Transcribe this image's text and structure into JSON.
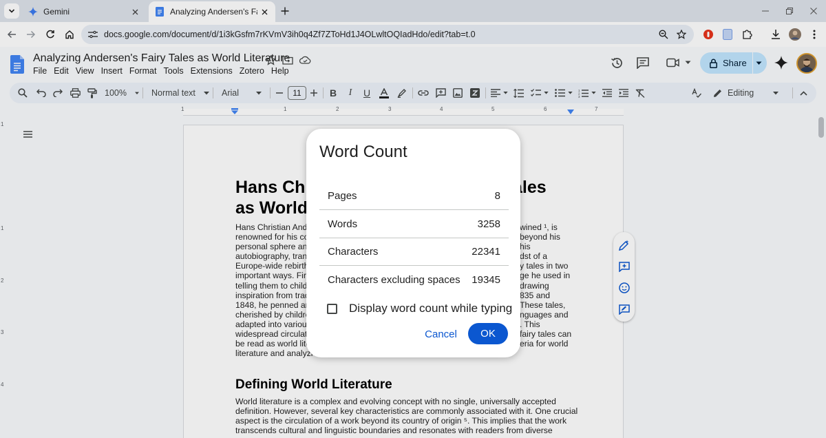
{
  "browser": {
    "tabs": [
      {
        "title": "Gemini",
        "active": false,
        "icon": "gemini-sparkle-icon"
      },
      {
        "title": "Analyzing Andersen's Fairy Tale",
        "active": true,
        "icon": "docs-icon"
      }
    ],
    "url": "docs.google.com/document/d/1i3kGsfm7rKVmV3ih0q4Zf7ZToHd1J4OLwltOQIadHdo/edit?tab=t.0"
  },
  "docs": {
    "title": "Analyzing Andersen's Fairy Tales as World Literature",
    "menu": [
      "File",
      "Edit",
      "View",
      "Insert",
      "Format",
      "Tools",
      "Extensions",
      "Zotero",
      "Help"
    ],
    "share_label": "Share"
  },
  "toolbar": {
    "zoom": "100%",
    "style": "Normal text",
    "font": "Arial",
    "font_size": "11",
    "mode": "Editing"
  },
  "ruler": {
    "numbers": [
      "1",
      "1",
      "2",
      "3",
      "4",
      "5",
      "6",
      "7"
    ],
    "vertical_numbers": [
      "1",
      "1",
      "2",
      "3",
      "4"
    ]
  },
  "document": {
    "heading_line1": "Hans Ch",
    "heading_line1_right": "ales",
    "heading_line2": "as World",
    "para1_left": [
      "Hans Christian Ande",
      "renowned for his col",
      "personal sphere and",
      "autobiography, trans",
      "Europe-wide rebirth",
      "important ways. First",
      "telling them to childre",
      "inspiration from tradi",
      "1848, he penned arc",
      "cherished by children",
      "adapted into various",
      "widespread circulatio",
      "be read as world lite",
      "literature and analyzi"
    ],
    "para1_right": [
      "wined ¹, is",
      " beyond his",
      "his",
      "dst of a",
      "y tales in two",
      "ge he used in",
      " drawing",
      "835 and",
      "These tales,",
      "nguages and",
      ". This",
      "fairy tales can",
      "eria for world",
      ""
    ],
    "heading2": "Defining World Literature",
    "para2": [
      "World literature is a complex and evolving concept with no single, universally accepted",
      "definition. However, several key characteristics are commonly associated with it. One crucial",
      "aspect is the circulation of a work beyond its country of origin ⁵. This implies that the work",
      "transcends cultural and linguistic boundaries and resonates with readers from diverse"
    ]
  },
  "dialog": {
    "title": "Word Count",
    "rows": [
      {
        "label": "Pages",
        "value": "8"
      },
      {
        "label": "Words",
        "value": "3258"
      },
      {
        "label": "Characters",
        "value": "22341"
      },
      {
        "label": "Characters excluding spaces",
        "value": "19345"
      }
    ],
    "checkbox_label": "Display word count while typing",
    "checkbox_checked": false,
    "cancel_label": "Cancel",
    "ok_label": "OK"
  },
  "colors": {
    "accent": "#0b57d0",
    "share_bg": "#c2e7ff",
    "docs_blue": "#4285f4"
  }
}
